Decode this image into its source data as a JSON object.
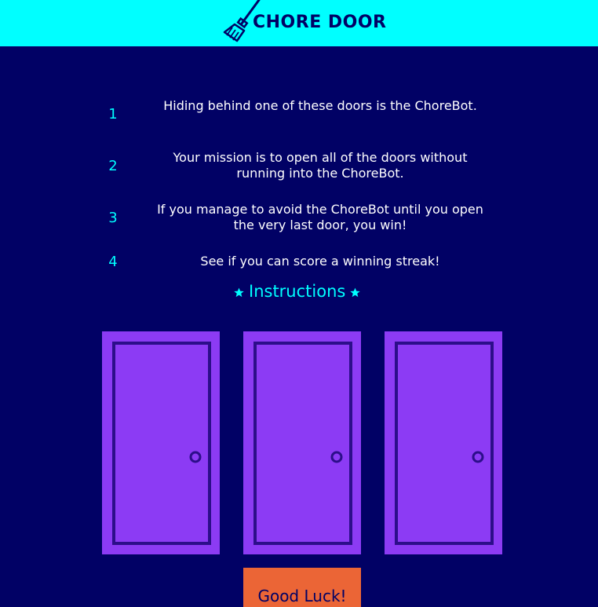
{
  "header": {
    "logo_icon": "broom-icon",
    "title": "CHORE DOOR"
  },
  "steps": [
    {
      "number": "1",
      "text": "Hiding behind one of these doors is the ChoreBot."
    },
    {
      "number": "2",
      "text": "Your mission is to open all of the doors without running into the ChoreBot."
    },
    {
      "number": "3",
      "text": "If you manage to avoid the ChoreBot until you open the very last door, you win!"
    },
    {
      "number": "4",
      "text": "See if you can score a winning streak!"
    }
  ],
  "instructions": {
    "label": "Instructions",
    "icon": "star-icon"
  },
  "doors": [
    {
      "icon": "closed-door-icon"
    },
    {
      "icon": "closed-door-icon"
    },
    {
      "icon": "closed-door-icon"
    }
  ],
  "start_button": {
    "label": "Good Luck!"
  },
  "colors": {
    "background": "#010165",
    "header": "#00ffff",
    "accent": "#00ffff",
    "door_fill": "#8c3bf4",
    "door_outline": "#2c0e8a",
    "button": "#eb6536",
    "text": "#ffffff"
  }
}
